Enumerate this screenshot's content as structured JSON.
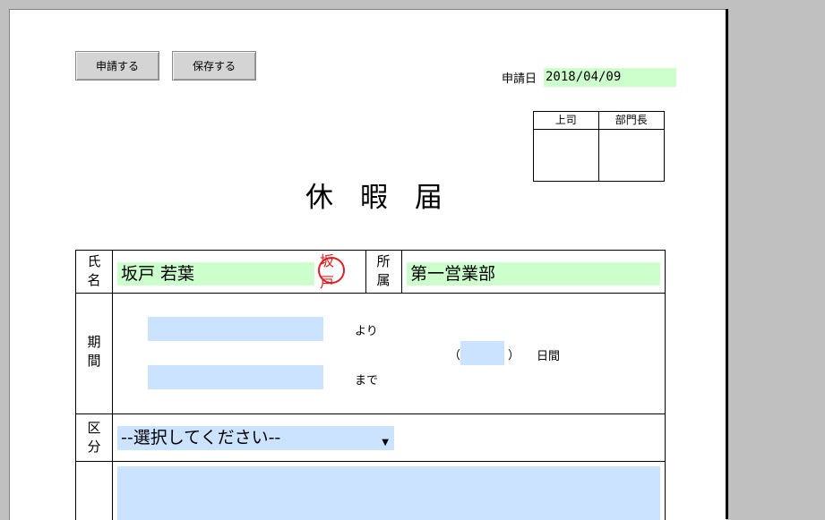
{
  "toolbar": {
    "apply_label": "申請する",
    "save_label": "保存する"
  },
  "header": {
    "date_label": "申請日",
    "date_value": "2018/04/09"
  },
  "approval": {
    "boss_label": "上司",
    "manager_label": "部門長"
  },
  "form": {
    "title": "休暇届",
    "name_label": "氏\n名",
    "name_value": "坂戸 若葉",
    "stamp_text": "坂戸",
    "dept_label": "所\n属",
    "dept_value": "第一営業部",
    "period_label": "期\n間",
    "from_suffix": "より",
    "to_suffix": "まで",
    "days_open": "（",
    "days_close": "）",
    "days_unit": "日間",
    "category_label": "区\n分",
    "category_selected": "--選択してください--"
  }
}
